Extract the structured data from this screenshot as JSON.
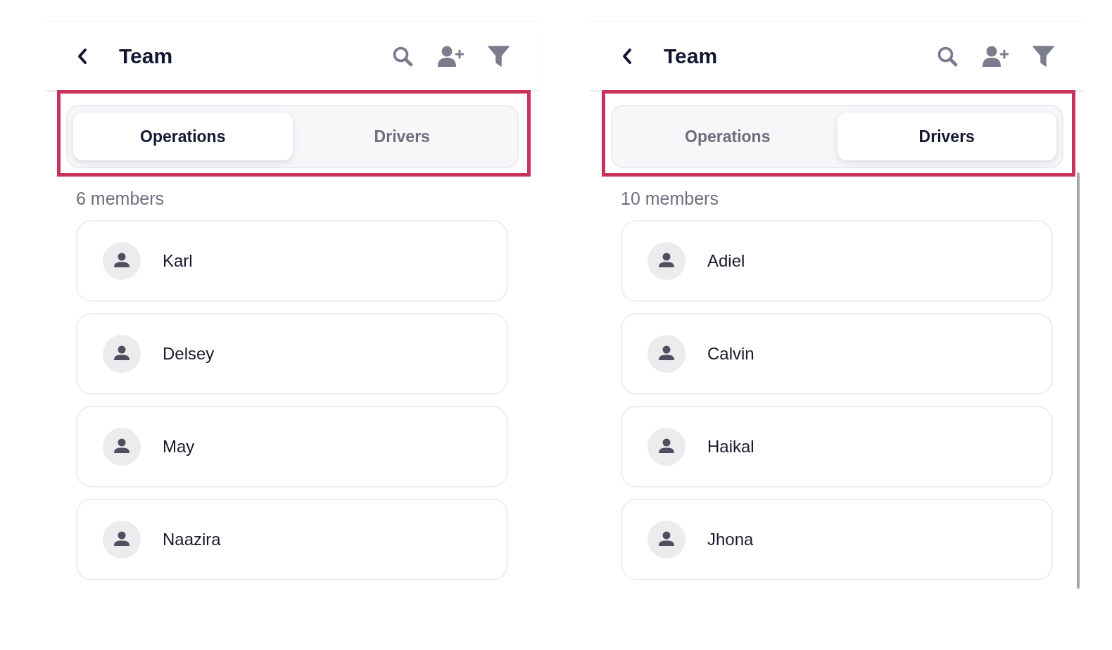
{
  "screens": [
    {
      "header": {
        "title": "Team"
      },
      "tabs_highlighted": true,
      "tabs": [
        {
          "label": "Operations",
          "selected": true
        },
        {
          "label": "Drivers",
          "selected": false
        }
      ],
      "member_count": "6 members",
      "members": [
        {
          "name": "Karl"
        },
        {
          "name": "Delsey"
        },
        {
          "name": "May"
        },
        {
          "name": "Naazira"
        }
      ],
      "scrollbar_shown": false
    },
    {
      "header": {
        "title": "Team"
      },
      "tabs_highlighted": true,
      "tabs": [
        {
          "label": "Operations",
          "selected": false
        },
        {
          "label": "Drivers",
          "selected": true
        }
      ],
      "member_count": "10 members",
      "members": [
        {
          "name": "Adiel"
        },
        {
          "name": "Calvin"
        },
        {
          "name": "Haikal"
        },
        {
          "name": "Jhona"
        }
      ],
      "scrollbar_shown": true
    }
  ]
}
